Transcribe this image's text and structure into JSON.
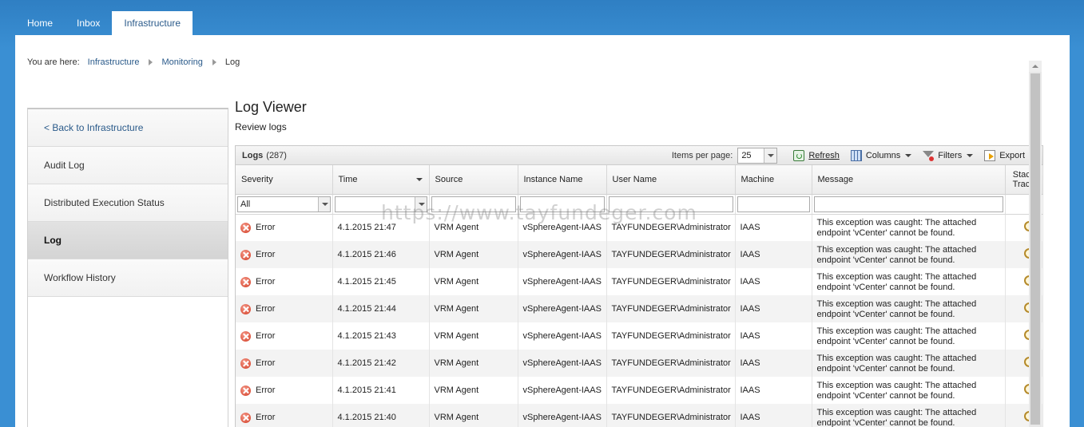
{
  "nav": {
    "tabs": [
      {
        "label": "Home",
        "active": false
      },
      {
        "label": "Inbox",
        "active": false
      },
      {
        "label": "Infrastructure",
        "active": true
      }
    ]
  },
  "breadcrumb": {
    "label": "You are here:",
    "items": [
      "Infrastructure",
      "Monitoring",
      "Log"
    ]
  },
  "sidebar": {
    "items": [
      {
        "label": "< Back to Infrastructure"
      },
      {
        "label": "Audit Log"
      },
      {
        "label": "Distributed Execution Status"
      },
      {
        "label": "Log"
      },
      {
        "label": "Workflow History"
      }
    ]
  },
  "page": {
    "title": "Log Viewer",
    "subtitle": "Review logs"
  },
  "grid": {
    "title": "Logs",
    "count": "(287)",
    "items_per_page_label": "Items per page:",
    "items_per_page": "25",
    "refresh_label": "Refresh",
    "columns_label": "Columns",
    "filters_label": "Filters",
    "export_label": "Export",
    "columns": [
      "Severity",
      "Time",
      "Source",
      "Instance Name",
      "User Name",
      "Machine",
      "Message",
      "Stack Trace"
    ],
    "severity_filter": "All",
    "rows": [
      {
        "severity": "Error",
        "time": "4.1.2015 21:47",
        "source": "VRM Agent",
        "instance": "vSphereAgent-IAAS",
        "user": "TAYFUNDEGER\\Administrator",
        "machine": "IAAS",
        "message": "This exception was caught: The attached endpoint 'vCenter' cannot be found."
      },
      {
        "severity": "Error",
        "time": "4.1.2015 21:46",
        "source": "VRM Agent",
        "instance": "vSphereAgent-IAAS",
        "user": "TAYFUNDEGER\\Administrator",
        "machine": "IAAS",
        "message": "This exception was caught: The attached endpoint 'vCenter' cannot be found."
      },
      {
        "severity": "Error",
        "time": "4.1.2015 21:45",
        "source": "VRM Agent",
        "instance": "vSphereAgent-IAAS",
        "user": "TAYFUNDEGER\\Administrator",
        "machine": "IAAS",
        "message": "This exception was caught: The attached endpoint 'vCenter' cannot be found."
      },
      {
        "severity": "Error",
        "time": "4.1.2015 21:44",
        "source": "VRM Agent",
        "instance": "vSphereAgent-IAAS",
        "user": "TAYFUNDEGER\\Administrator",
        "machine": "IAAS",
        "message": "This exception was caught: The attached endpoint 'vCenter' cannot be found."
      },
      {
        "severity": "Error",
        "time": "4.1.2015 21:43",
        "source": "VRM Agent",
        "instance": "vSphereAgent-IAAS",
        "user": "TAYFUNDEGER\\Administrator",
        "machine": "IAAS",
        "message": "This exception was caught: The attached endpoint 'vCenter' cannot be found."
      },
      {
        "severity": "Error",
        "time": "4.1.2015 21:42",
        "source": "VRM Agent",
        "instance": "vSphereAgent-IAAS",
        "user": "TAYFUNDEGER\\Administrator",
        "machine": "IAAS",
        "message": "This exception was caught: The attached endpoint 'vCenter' cannot be found."
      },
      {
        "severity": "Error",
        "time": "4.1.2015 21:41",
        "source": "VRM Agent",
        "instance": "vSphereAgent-IAAS",
        "user": "TAYFUNDEGER\\Administrator",
        "machine": "IAAS",
        "message": "This exception was caught: The attached endpoint 'vCenter' cannot be found."
      },
      {
        "severity": "Error",
        "time": "4.1.2015 21:40",
        "source": "VRM Agent",
        "instance": "vSphereAgent-IAAS",
        "user": "TAYFUNDEGER\\Administrator",
        "machine": "IAAS",
        "message": "This exception was caught: The attached endpoint 'vCenter' cannot be found."
      }
    ]
  },
  "watermark": "https://www.tayfundeger.com",
  "icons": {
    "severity": "error-icon",
    "stack_trace": "magnifier-icon",
    "refresh": "refresh-icon",
    "columns": "columns-icon",
    "filters": "filter-icon",
    "export": "export-icon"
  }
}
